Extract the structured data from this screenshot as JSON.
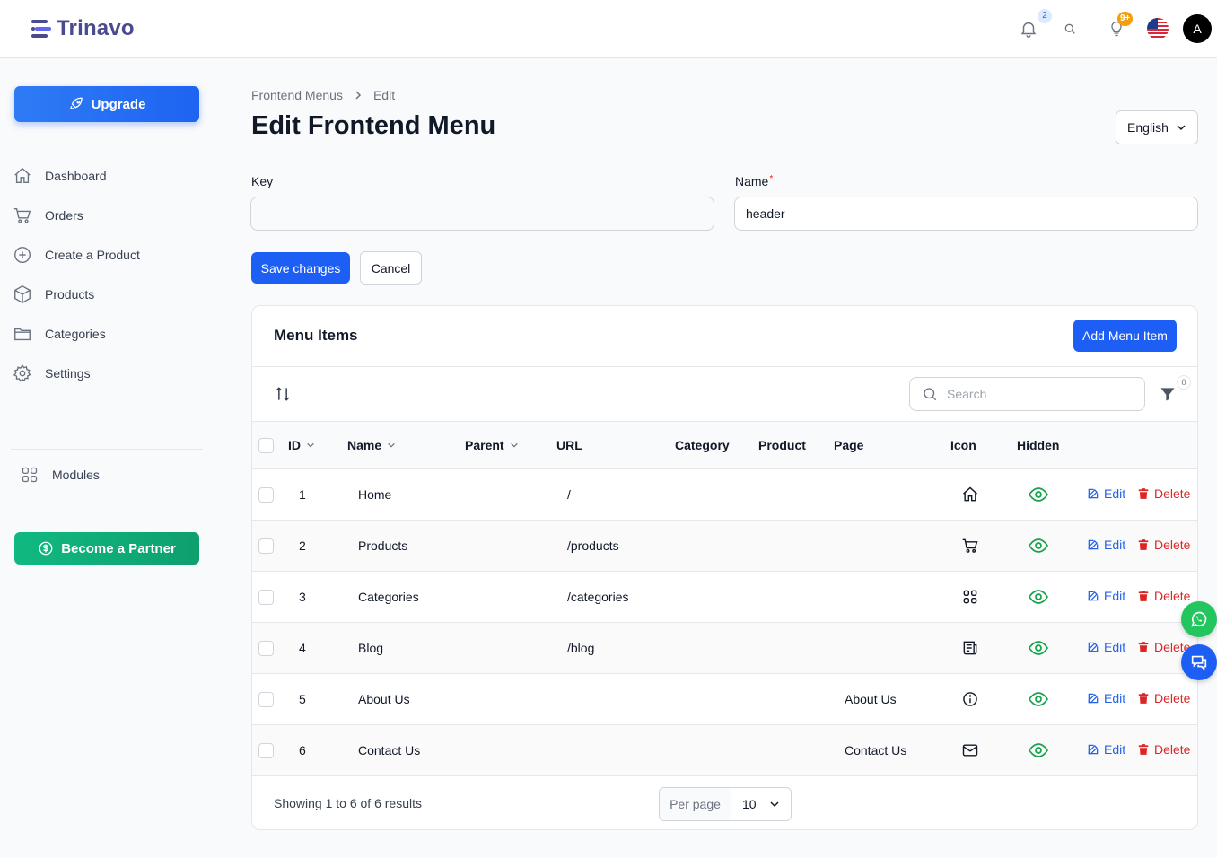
{
  "app": {
    "name": "Trinavo"
  },
  "topbar": {
    "notifications_count": "2",
    "tips_count": "9+",
    "user_initial": "A"
  },
  "sidebar": {
    "upgrade_label": "Upgrade",
    "items": [
      {
        "label": "Dashboard",
        "icon": "home-icon"
      },
      {
        "label": "Orders",
        "icon": "cart-icon"
      },
      {
        "label": "Create a Product",
        "icon": "plus-circle-icon"
      },
      {
        "label": "Products",
        "icon": "box-icon"
      },
      {
        "label": "Categories",
        "icon": "folder-icon"
      },
      {
        "label": "Settings",
        "icon": "gear-icon"
      }
    ],
    "modules_label": "Modules",
    "partner_label": "Become a Partner"
  },
  "breadcrumb": {
    "parent": "Frontend Menus",
    "current": "Edit"
  },
  "page": {
    "title": "Edit Frontend Menu",
    "language": "English"
  },
  "form": {
    "key_label": "Key",
    "key_value": "",
    "name_label": "Name",
    "name_required_mark": "*",
    "name_value": "header",
    "save_label": "Save changes",
    "cancel_label": "Cancel"
  },
  "menu_items": {
    "title": "Menu Items",
    "add_label": "Add Menu Item",
    "search_placeholder": "Search",
    "filter_count": "0",
    "columns": [
      "ID",
      "Name",
      "Parent",
      "URL",
      "Category",
      "Product",
      "Page",
      "Icon",
      "Hidden"
    ],
    "edit_label": "Edit",
    "delete_label": "Delete",
    "rows": [
      {
        "id": "1",
        "name": "Home",
        "parent": "",
        "url": "/",
        "category": "",
        "product": "",
        "page": "",
        "icon": "home-icon"
      },
      {
        "id": "2",
        "name": "Products",
        "parent": "",
        "url": "/products",
        "category": "",
        "product": "",
        "page": "",
        "icon": "cart-icon"
      },
      {
        "id": "3",
        "name": "Categories",
        "parent": "",
        "url": "/categories",
        "category": "",
        "product": "",
        "page": "",
        "icon": "grid-icon"
      },
      {
        "id": "4",
        "name": "Blog",
        "parent": "",
        "url": "/blog",
        "category": "",
        "product": "",
        "page": "",
        "icon": "newspaper-icon"
      },
      {
        "id": "5",
        "name": "About Us",
        "parent": "",
        "url": "",
        "category": "",
        "product": "",
        "page": "About Us",
        "icon": "info-icon"
      },
      {
        "id": "6",
        "name": "Contact Us",
        "parent": "",
        "url": "",
        "category": "",
        "product": "",
        "page": "Contact Us",
        "icon": "mail-icon"
      }
    ],
    "showing": "Showing 1 to 6 of 6 results",
    "per_page_label": "Per page",
    "per_page_value": "10"
  },
  "colors": {
    "primary": "#1d5ff5",
    "success": "#16a34a",
    "danger": "#dc2626",
    "brand": "#4a4a8e"
  }
}
